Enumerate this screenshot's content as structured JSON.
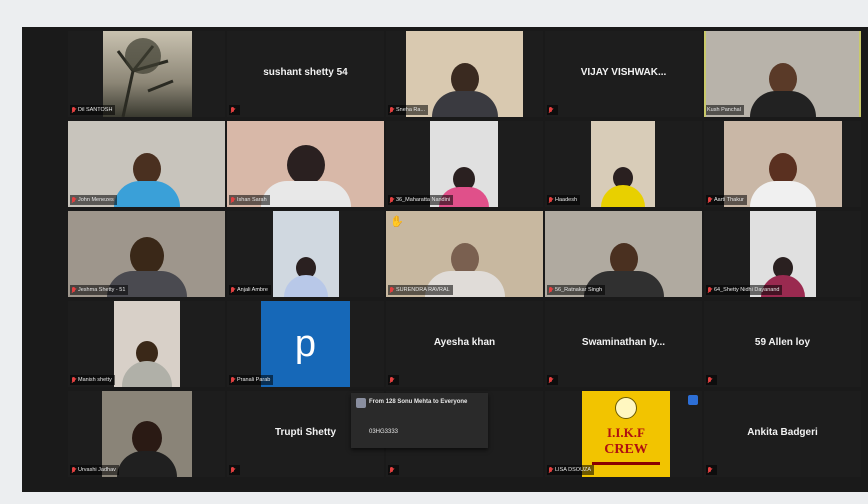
{
  "tiles": [
    {
      "label": "Dil SANTOSH",
      "name": ""
    },
    {
      "label": "",
      "name": "sushant shetty 54"
    },
    {
      "label": "Sneha Ra...",
      "name": ""
    },
    {
      "label": "",
      "name": "VIJAY  VISHWAK..."
    },
    {
      "label": "Kush Panchal",
      "name": ""
    },
    {
      "label": "John Menezes",
      "name": ""
    },
    {
      "label": "Ishan Sarah",
      "name": ""
    },
    {
      "label": "36_Maharatta Nandini",
      "name": ""
    },
    {
      "label": "Haadesh",
      "name": ""
    },
    {
      "label": "Aarti Thakur",
      "name": ""
    },
    {
      "label": "Jeshma Shetty - 51",
      "name": ""
    },
    {
      "label": "Anjali Ambre",
      "name": ""
    },
    {
      "label": "SURENDRA RAVRAL",
      "name": ""
    },
    {
      "label": "56_Ratnakar Singh",
      "name": ""
    },
    {
      "label": "64_Shetty Nidhi Dayanand",
      "name": ""
    },
    {
      "label": "Manish shetty",
      "name": ""
    },
    {
      "label": "Pranali Parab",
      "name": "",
      "logo_text": "p"
    },
    {
      "label": "",
      "name": "Ayesha khan"
    },
    {
      "label": "",
      "name": "Swaminathan  Iy..."
    },
    {
      "label": "",
      "name": "59 Allen loy"
    },
    {
      "label": "Urvashi Jadhav",
      "name": ""
    },
    {
      "label": "",
      "name": "Trupti Shetty"
    },
    {
      "label": "",
      "name": ""
    },
    {
      "label": "LISA DSOUZA",
      "name": "",
      "logo_line1": "I.I.K.F",
      "logo_line2": "CREW"
    },
    {
      "label": "",
      "name": "Ankita Badgeri"
    }
  ],
  "chat": {
    "message": "From 128 Sonu Mehta to Everyone",
    "text": "03HG3333"
  },
  "colors": {
    "stage": "#1a1a1a",
    "tile": "#1d1d1d",
    "active_border": "#c9c96a",
    "muted_mic": "#e34040",
    "logo_blue": "#1668b8",
    "crew_yellow": "#f2c400",
    "crew_red": "#b01010"
  },
  "icons": [
    "muted-mic-icon",
    "raised-hand-icon",
    "chat-avatar-icon",
    "notification-badge-icon"
  ]
}
